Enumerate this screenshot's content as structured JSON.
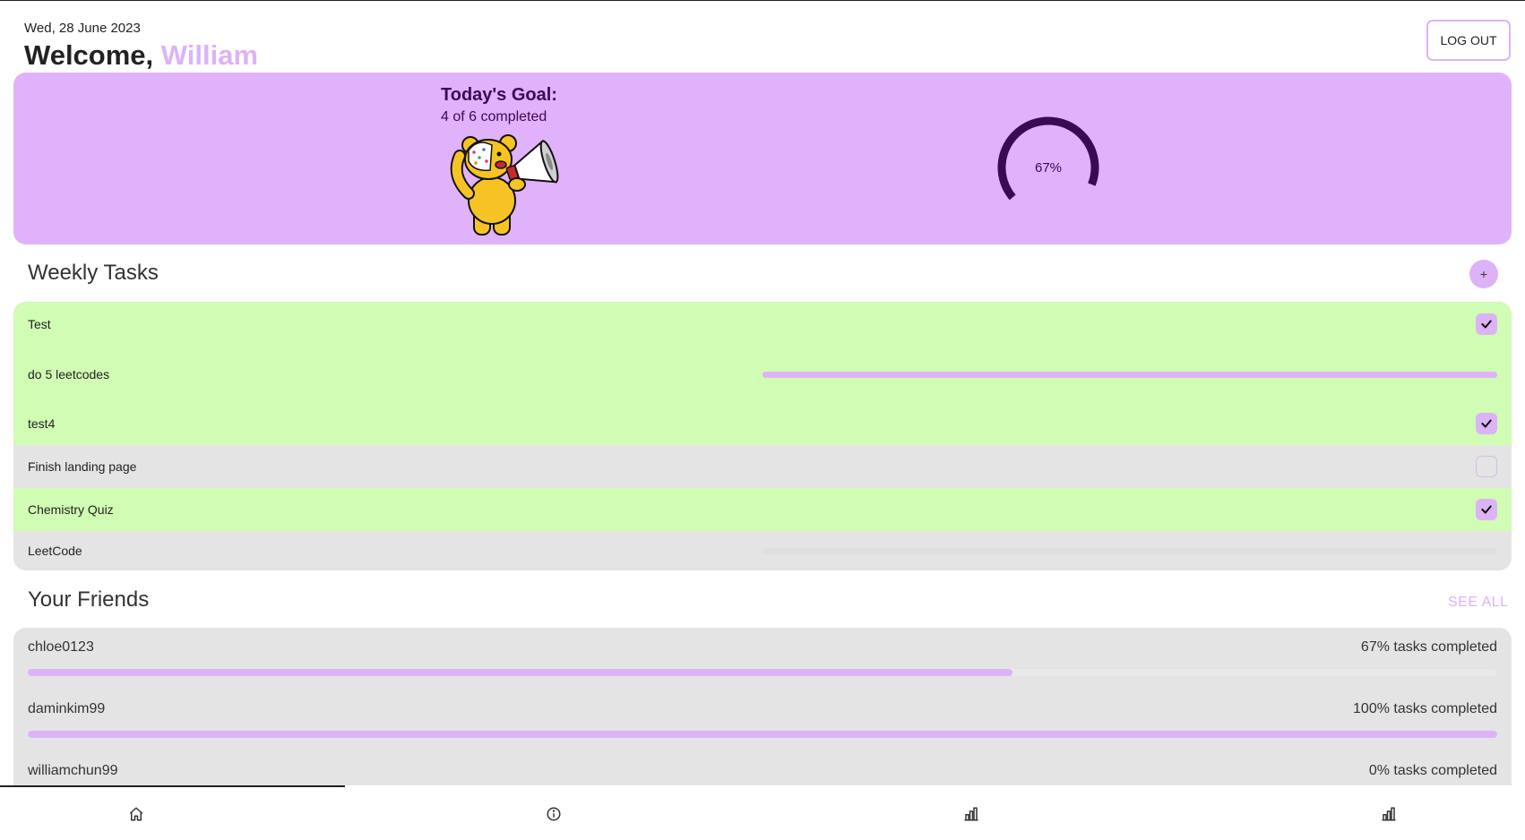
{
  "header": {
    "date": "Wed, 28 June 2023",
    "welcome_prefix": "Welcome, ",
    "user_name": "William",
    "logout_label": "LOG OUT"
  },
  "goal": {
    "title": "Today's Goal:",
    "progress_text": "4 of 6 completed",
    "percent_label": "67%",
    "percent_value": 67,
    "mascot_icon": "bear-megaphone-icon"
  },
  "weekly_tasks": {
    "title": "Weekly Tasks",
    "add_label": "+",
    "items": [
      {
        "label": "Test",
        "status": "done",
        "control": "checkbox",
        "checked": true
      },
      {
        "label": "do 5 leetcodes",
        "status": "done",
        "control": "progress",
        "progress": 100
      },
      {
        "label": "test4",
        "status": "done",
        "control": "checkbox",
        "checked": true
      },
      {
        "label": "Finish landing page",
        "status": "pending",
        "control": "checkbox",
        "checked": false
      },
      {
        "label": "Chemistry Quiz",
        "status": "done",
        "control": "checkbox",
        "checked": true
      },
      {
        "label": "LeetCode",
        "status": "pending",
        "control": "progress",
        "progress": 0
      }
    ]
  },
  "friends": {
    "title": "Your Friends",
    "see_all_label": "SEE ALL",
    "items": [
      {
        "name": "chloe0123",
        "status": "67% tasks completed",
        "progress": 67
      },
      {
        "name": "daminkim99",
        "status": "100% tasks completed",
        "progress": 100
      },
      {
        "name": "williamchun99",
        "status": "0% tasks completed",
        "progress": 0
      }
    ]
  },
  "nav": {
    "items": [
      {
        "icon": "home-icon"
      },
      {
        "icon": "info-icon"
      },
      {
        "icon": "bar-chart-icon"
      },
      {
        "icon": "bar-chart-icon"
      }
    ]
  },
  "colors": {
    "accent": "#dcb3f7",
    "goal_card": "#e0b2fb",
    "ring": "#3b0a54",
    "done_row": "#d1fcb3",
    "pending_row": "#e4e4e4"
  }
}
